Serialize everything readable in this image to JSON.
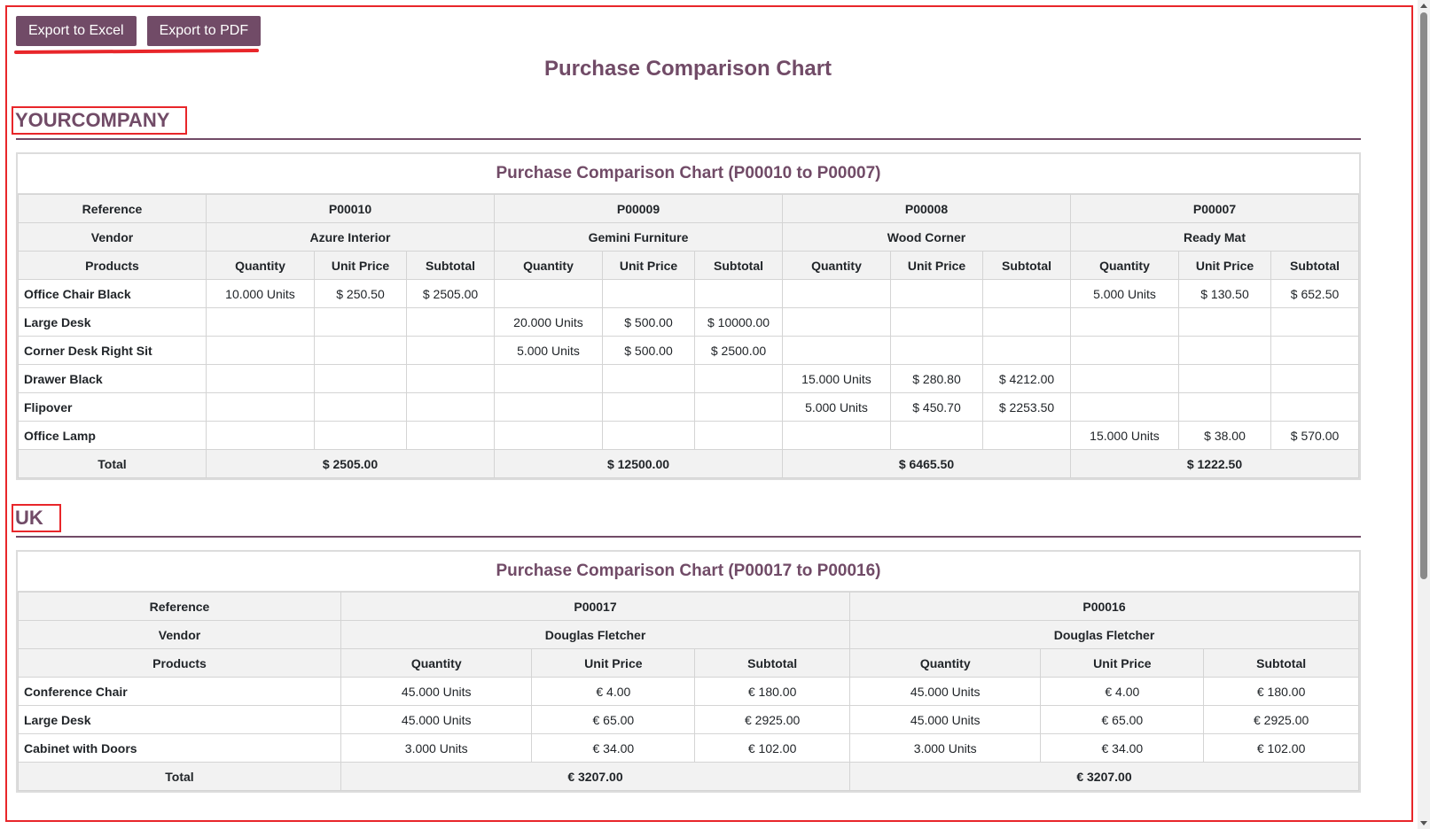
{
  "toolbar": {
    "export_excel": "Export to Excel",
    "export_pdf": "Export to PDF"
  },
  "page_title": "Purchase Comparison Chart",
  "row_labels": {
    "reference": "Reference",
    "vendor": "Vendor",
    "products": "Products",
    "total": "Total"
  },
  "col_labels": {
    "quantity": "Quantity",
    "unit_price": "Unit Price",
    "subtotal": "Subtotal"
  },
  "companies": [
    {
      "name": "YOURCOMPANY",
      "table_title": "Purchase Comparison Chart (P00010 to P00007)",
      "orders": [
        {
          "ref": "P00010",
          "vendor": "Azure Interior",
          "total": "$ 2505.00"
        },
        {
          "ref": "P00009",
          "vendor": "Gemini Furniture",
          "total": "$ 12500.00"
        },
        {
          "ref": "P00008",
          "vendor": "Wood Corner",
          "total": "$ 6465.50"
        },
        {
          "ref": "P00007",
          "vendor": "Ready Mat",
          "total": "$ 1222.50"
        }
      ],
      "products": [
        {
          "name": "Office Chair Black",
          "cells": [
            [
              "10.000 Units",
              "$ 250.50",
              "$ 2505.00"
            ],
            [
              "",
              "",
              ""
            ],
            [
              "",
              "",
              ""
            ],
            [
              "5.000 Units",
              "$ 130.50",
              "$ 652.50"
            ]
          ]
        },
        {
          "name": "Large Desk",
          "cells": [
            [
              "",
              "",
              ""
            ],
            [
              "20.000 Units",
              "$ 500.00",
              "$ 10000.00"
            ],
            [
              "",
              "",
              ""
            ],
            [
              "",
              "",
              ""
            ]
          ]
        },
        {
          "name": "Corner Desk Right Sit",
          "cells": [
            [
              "",
              "",
              ""
            ],
            [
              "5.000 Units",
              "$ 500.00",
              "$ 2500.00"
            ],
            [
              "",
              "",
              ""
            ],
            [
              "",
              "",
              ""
            ]
          ]
        },
        {
          "name": "Drawer Black",
          "cells": [
            [
              "",
              "",
              ""
            ],
            [
              "",
              "",
              ""
            ],
            [
              "15.000 Units",
              "$ 280.80",
              "$ 4212.00"
            ],
            [
              "",
              "",
              ""
            ]
          ]
        },
        {
          "name": "Flipover",
          "cells": [
            [
              "",
              "",
              ""
            ],
            [
              "",
              "",
              ""
            ],
            [
              "5.000 Units",
              "$ 450.70",
              "$ 2253.50"
            ],
            [
              "",
              "",
              ""
            ]
          ]
        },
        {
          "name": "Office Lamp",
          "cells": [
            [
              "",
              "",
              ""
            ],
            [
              "",
              "",
              ""
            ],
            [
              "",
              "",
              ""
            ],
            [
              "15.000 Units",
              "$ 38.00",
              "$ 570.00"
            ]
          ]
        }
      ]
    },
    {
      "name": "UK",
      "table_title": "Purchase Comparison Chart (P00017 to P00016)",
      "orders": [
        {
          "ref": "P00017",
          "vendor": "Douglas Fletcher",
          "total": "€ 3207.00"
        },
        {
          "ref": "P00016",
          "vendor": "Douglas Fletcher",
          "total": "€ 3207.00"
        }
      ],
      "products": [
        {
          "name": "Conference Chair",
          "cells": [
            [
              "45.000 Units",
              "€ 4.00",
              "€ 180.00"
            ],
            [
              "45.000 Units",
              "€ 4.00",
              "€ 180.00"
            ]
          ]
        },
        {
          "name": "Large Desk",
          "cells": [
            [
              "45.000 Units",
              "€ 65.00",
              "€ 2925.00"
            ],
            [
              "45.000 Units",
              "€ 65.00",
              "€ 2925.00"
            ]
          ]
        },
        {
          "name": "Cabinet with Doors",
          "cells": [
            [
              "3.000 Units",
              "€ 34.00",
              "€ 102.00"
            ],
            [
              "3.000 Units",
              "€ 34.00",
              "€ 102.00"
            ]
          ]
        }
      ]
    }
  ]
}
